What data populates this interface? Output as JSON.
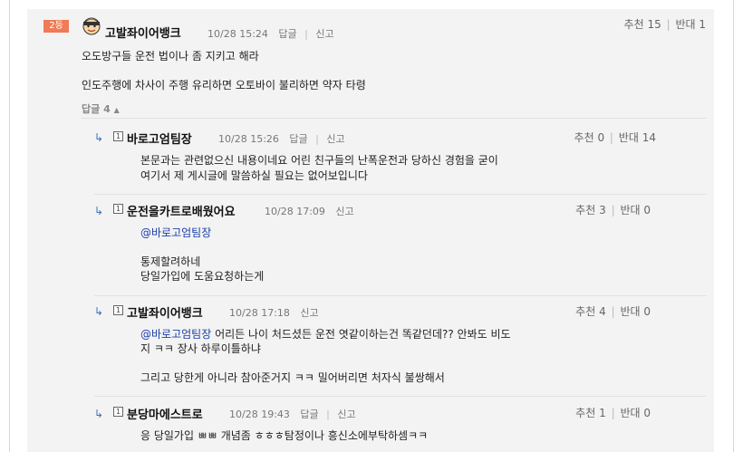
{
  "comment": {
    "rank": "2등",
    "author": "고발좌이어뱅크",
    "time": "10/28 15:24",
    "reply_label": "답글",
    "report_label": "신고",
    "recommend_label": "추천",
    "recommend_count": "15",
    "oppose_label": "반대",
    "oppose_count": "1",
    "lines": [
      "오도방구들 운전 법이나 좀 지키고 해라",
      "인도주행에 차사이 주행 유리하면 오토바이 불리하면 약자 타령"
    ],
    "reply_count_label": "답글 4"
  },
  "replies": [
    {
      "author": "바로고엄팀장",
      "time": "10/28 15:26",
      "reply_label": "답글",
      "report_label": "신고",
      "recommend_label": "추천",
      "recommend_count": "0",
      "oppose_label": "반대",
      "oppose_count": "14",
      "mention": "",
      "lines": [
        "본문과는 관련없으신 내용이네요 어린 친구들의 난폭운전과 당하신 경험을 굳이",
        "여기서 제 게시글에 말씀하실 필요는 없어보입니다"
      ]
    },
    {
      "author": "운전을카트로배웠어요",
      "time": "10/28 17:09",
      "reply_label": "",
      "report_label": "신고",
      "recommend_label": "추천",
      "recommend_count": "3",
      "oppose_label": "반대",
      "oppose_count": "0",
      "mention": "@바로고엄팀장",
      "lines": [
        "통제할려하네",
        "당일가입에 도움요청하는게"
      ]
    },
    {
      "author": "고발좌이어뱅크",
      "time": "10/28 17:18",
      "reply_label": "",
      "report_label": "신고",
      "recommend_label": "추천",
      "recommend_count": "4",
      "oppose_label": "반대",
      "oppose_count": "0",
      "mention": "@바로고엄팀장",
      "first_line_rest": " 어리든 나이 처드셨든 운전 엿같이하는건 똑같던데?? 안봐도 비도",
      "lines": [
        "지 ㅋㅋ 장사 하루이틀하냐",
        "그리고 당한게 아니라 참아준거지 ㅋㅋ 밀어버리면 처자식 불쌍해서"
      ]
    },
    {
      "author": "분당마에스트로",
      "time": "10/28 19:43",
      "reply_label": "답글",
      "report_label": "신고",
      "recommend_label": "추천",
      "recommend_count": "1",
      "oppose_label": "반대",
      "oppose_count": "0",
      "mention": "",
      "lines": [
        "응 당일가입 ㅃㅃ 개념좀 ㅎㅎㅎ탐정이나 흥신소에부탁하셈ㅋㅋ"
      ]
    }
  ],
  "colors": {
    "rank_badge": "#f07b56",
    "panel_bg": "#f3f3f3",
    "mention": "#1a3fa8",
    "reply_arrow": "#3a70b8"
  },
  "icons": {
    "avatar": "cartoon-face-avatar",
    "reply_arrow": "reply-arrow-icon",
    "member_badge": "member-badge-icon",
    "collapse": "caret-up-icon"
  }
}
